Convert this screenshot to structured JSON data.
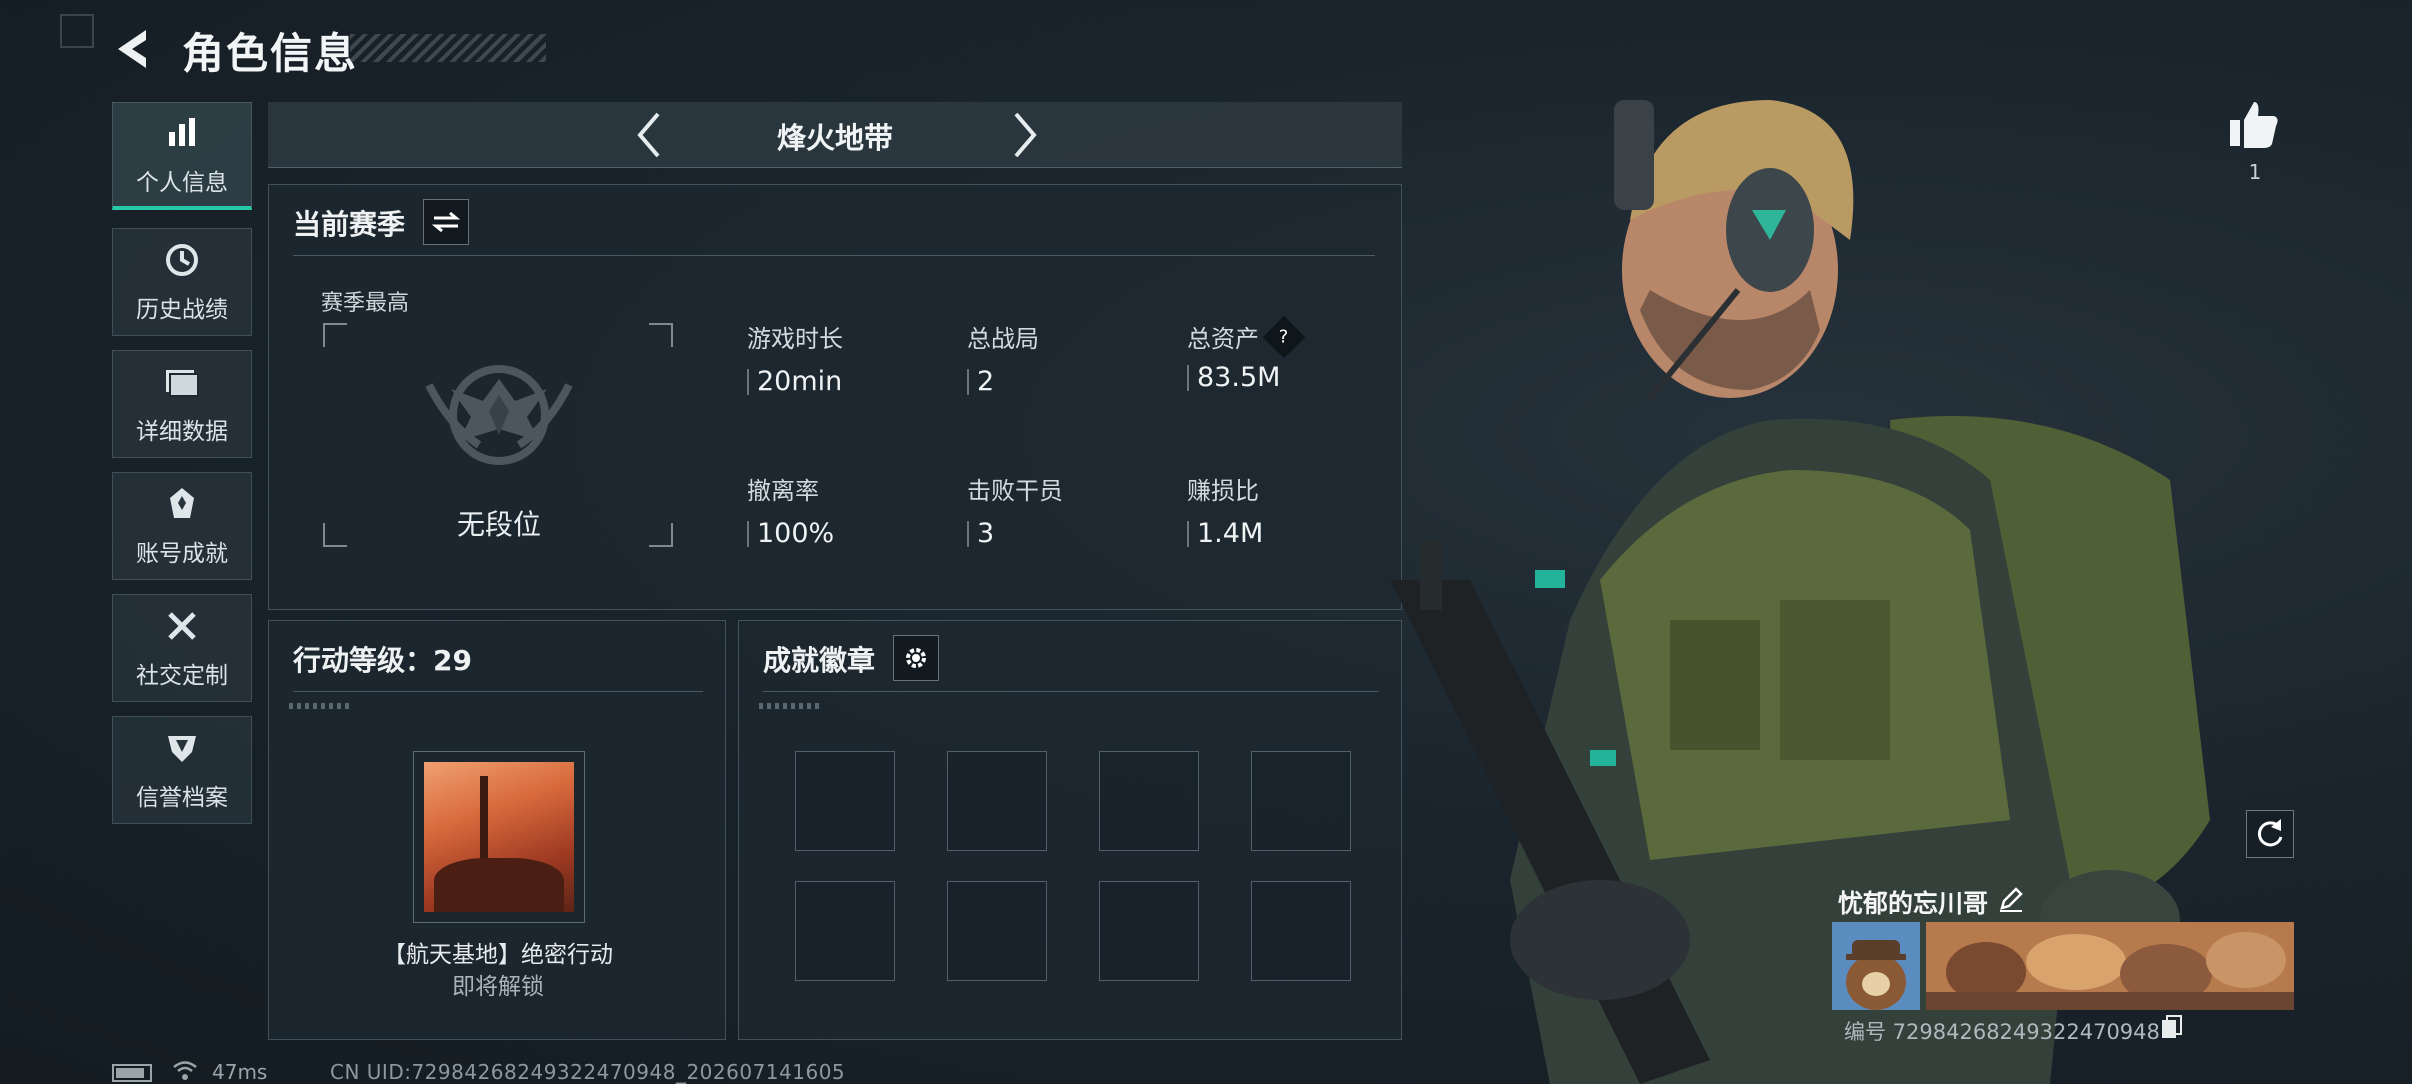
{
  "header": {
    "title": "角色信息"
  },
  "sidebar": {
    "items": [
      {
        "label": "个人信息",
        "icon": "bar-chart-icon",
        "active": true
      },
      {
        "label": "历史战绩",
        "icon": "history-clock-icon",
        "active": false
      },
      {
        "label": "详细数据",
        "icon": "folder-icon",
        "active": false
      },
      {
        "label": "账号成就",
        "icon": "achievement-icon",
        "active": false
      },
      {
        "label": "社交定制",
        "icon": "tools-icon",
        "active": false
      },
      {
        "label": "信誉档案",
        "icon": "credit-shield-icon",
        "active": false
      }
    ]
  },
  "map_selector": {
    "name": "烽火地带"
  },
  "season": {
    "title": "当前赛季",
    "peak_label": "赛季最高",
    "rank_text": "无段位",
    "stats": [
      {
        "label": "游戏时长",
        "value": "20min"
      },
      {
        "label": "总战局",
        "value": "2"
      },
      {
        "label": "总资产",
        "value": "83.5M"
      },
      {
        "label": "撤离率",
        "value": "100%"
      },
      {
        "label": "击败干员",
        "value": "3"
      },
      {
        "label": "赚损比",
        "value": "1.4M"
      }
    ]
  },
  "operation_level": {
    "title": "行动等级：29",
    "item_name": "【航天基地】绝密行动",
    "item_status": "即将解锁"
  },
  "badges": {
    "title": "成就徽章",
    "slot_count": 8
  },
  "character": {
    "like_count": "1",
    "player_name": "忧郁的忘川哥",
    "player_id": "编号 7298426824932247094​8"
  },
  "status_bar": {
    "ping": "47ms",
    "uid": "CN UID:7298426824932247094​8_202607141605"
  },
  "colors": {
    "accent": "#25c9a8",
    "panel": "#1e282f",
    "text": "#e6ecef"
  }
}
